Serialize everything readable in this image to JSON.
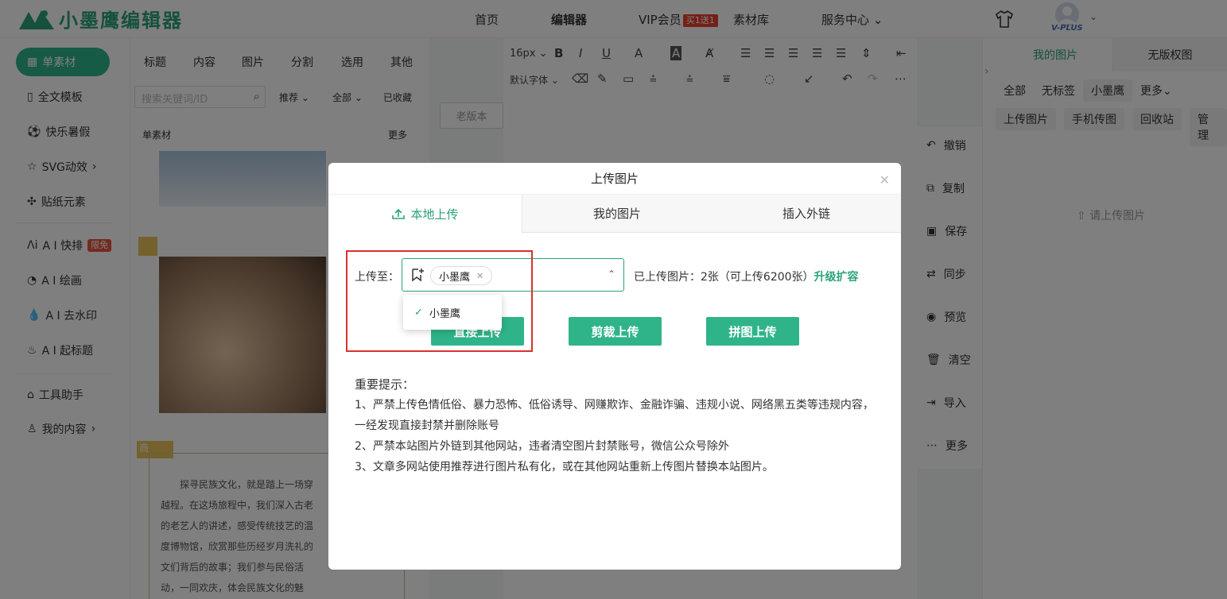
{
  "header": {
    "logo_text": "小墨鹰编辑器",
    "nav": [
      "首页",
      "编辑器",
      "VIP会员",
      "素材库",
      "服务中心"
    ],
    "vip_badge": "买1送1",
    "avatar_badge": "V-PLUS"
  },
  "left_nav": {
    "items": [
      {
        "label": "单素材",
        "icon": "grid-icon"
      },
      {
        "label": "全文模板",
        "icon": "template-icon"
      },
      {
        "label": "快乐暑假",
        "icon": "ball-icon"
      },
      {
        "label": "SVG动效",
        "icon": "star-icon"
      },
      {
        "label": "贴纸元素",
        "icon": "puzzle-icon"
      },
      {
        "label": "A I 快排",
        "icon": "ai-icon",
        "badge": "限免"
      },
      {
        "label": "A I 绘画",
        "icon": "palette-icon"
      },
      {
        "label": "A I 去水印",
        "icon": "drop-icon"
      },
      {
        "label": "A I 起标题",
        "icon": "flame-icon"
      },
      {
        "label": "工具助手",
        "icon": "tool-icon"
      },
      {
        "label": "我的内容",
        "icon": "user-icon"
      }
    ]
  },
  "material_panel": {
    "tabs": [
      "标题",
      "内容",
      "图片",
      "分割",
      "选用",
      "其他"
    ],
    "search_placeholder": "搜索关键词/ID",
    "filters": [
      "推荐",
      "全部",
      "已收藏"
    ],
    "section_title": "单素材",
    "section_more": "更多",
    "article_text": "探寻民族文化，就是踏上一场穿越程。在这场旅程中，我们深入古老的老艺人的讲述，感受传统技艺的温度博物馆，欣赏那些历经岁月洗礼的文们背后的故事；我们参与民俗活动，一同欢庆，体会民族文化的魅力。每一次探寻，",
    "tag_shang": "商"
  },
  "editor": {
    "font_size": "16px",
    "font_family": "默认字体",
    "old_version": "老版本"
  },
  "right_actions": [
    "撤销",
    "复制",
    "保存",
    "同步",
    "预览",
    "清空",
    "导入",
    "更多"
  ],
  "right_panel": {
    "tabs": [
      "我的图片",
      "无版权图"
    ],
    "filter_chips": [
      "全部",
      "无标签",
      "小墨鹰",
      "更多"
    ],
    "action_chips": [
      "上传图片",
      "手机传图",
      "回收站",
      "管理"
    ],
    "empty_text": "请上传图片"
  },
  "modal": {
    "title": "上传图片",
    "tabs": [
      "本地上传",
      "我的图片",
      "插入外链"
    ],
    "upload_to_label": "上传至：",
    "selected_tag": "小墨鹰",
    "dropdown_option": "小墨鹰",
    "quota_text": "已上传图片：2张（可上传6200张）",
    "upgrade_link": "升级扩容",
    "buttons": [
      "直接上传",
      "剪裁上传",
      "拼图上传"
    ],
    "notes_title": "重要提示：",
    "notes": [
      "1、严禁上传色情低俗、暴力恐怖、低俗诱导、网赚欺诈、金融诈骗、违规小说、网络黑五类等违规内容，一经发现直接封禁并删除账号",
      "2、严禁本站图片外链到其他网站，违者清空图片封禁账号，微信公众号除外",
      "3、文章多网站使用推荐进行图片私有化，或在其他网站重新上传图片替换本站图片。"
    ]
  },
  "colors": {
    "accent": "#2ba37a",
    "highlight_border": "#d9322c",
    "badge_red": "#e8412f"
  }
}
